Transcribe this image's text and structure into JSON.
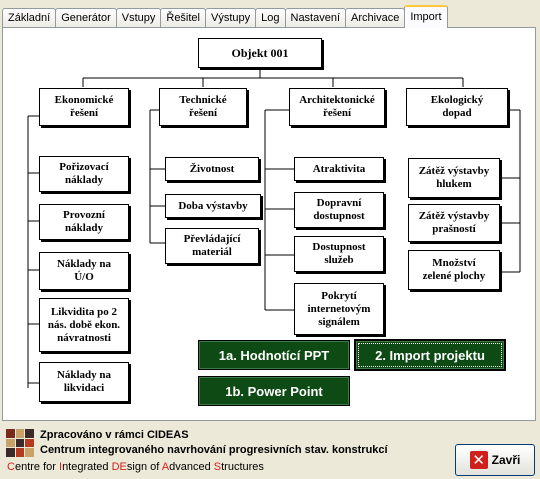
{
  "tabs": [
    {
      "label": "Základní"
    },
    {
      "label": "Generátor"
    },
    {
      "label": "Vstupy"
    },
    {
      "label": "Řešitel"
    },
    {
      "label": "Výstupy"
    },
    {
      "label": "Log"
    },
    {
      "label": "Nastavení"
    },
    {
      "label": "Archivace"
    },
    {
      "label": "Import"
    }
  ],
  "active_tab": "Import",
  "diagram": {
    "root": "Objekt 001",
    "categories": [
      {
        "label": "Ekonomické\nřešení",
        "items": [
          "Pořizovací\nnáklady",
          "Provozní\nnáklady",
          "Náklady na\nÚ/O",
          "Likvidita po 2\nnás. době ekon.\nnávratnosti",
          "Náklady na\nlikvidaci"
        ]
      },
      {
        "label": "Technické\nřešení",
        "items": [
          "Životnost",
          "Doba výstavby",
          "Převládající\nmateriál"
        ]
      },
      {
        "label": "Architektonické\nřešení",
        "items": [
          "Atraktivita",
          "Dopravní\ndostupnost",
          "Dostupnost\nslužeb",
          "Pokrytí\ninternetovým\nsignálem"
        ]
      },
      {
        "label": "Ekologický\ndopad",
        "items": [
          "Zátěž výstavby\nhlukem",
          "Zátěž výstavby\nprašností",
          "Množství\nzelené plochy"
        ]
      }
    ]
  },
  "buttons": {
    "hodnotici_ppt": "1a. Hodnotící PPT",
    "import_projektu": "2. Import projektu",
    "power_point": "1b. Power Point",
    "close": "Zavři"
  },
  "footer": {
    "line1": "Zpracováno v rámci CIDEAS",
    "line2": "Centrum integrovaného navrhování progresivních stav. konstrukcí",
    "line3": "Centre for Integrated DEsign of Advanced Structures"
  },
  "colors": {
    "green_button": "#0e4a14",
    "close_icon": "#d0201d",
    "active_tab_accent": "#ffc83c"
  }
}
